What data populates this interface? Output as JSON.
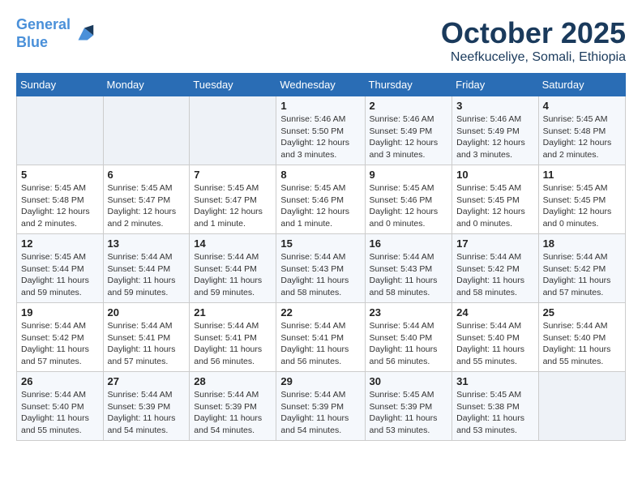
{
  "header": {
    "logo_line1": "General",
    "logo_line2": "Blue",
    "month": "October 2025",
    "location": "Neefkuceliye, Somali, Ethiopia"
  },
  "columns": [
    "Sunday",
    "Monday",
    "Tuesday",
    "Wednesday",
    "Thursday",
    "Friday",
    "Saturday"
  ],
  "weeks": [
    [
      {
        "day": "",
        "detail": ""
      },
      {
        "day": "",
        "detail": ""
      },
      {
        "day": "",
        "detail": ""
      },
      {
        "day": "1",
        "detail": "Sunrise: 5:46 AM\nSunset: 5:50 PM\nDaylight: 12 hours\nand 3 minutes."
      },
      {
        "day": "2",
        "detail": "Sunrise: 5:46 AM\nSunset: 5:49 PM\nDaylight: 12 hours\nand 3 minutes."
      },
      {
        "day": "3",
        "detail": "Sunrise: 5:46 AM\nSunset: 5:49 PM\nDaylight: 12 hours\nand 3 minutes."
      },
      {
        "day": "4",
        "detail": "Sunrise: 5:45 AM\nSunset: 5:48 PM\nDaylight: 12 hours\nand 2 minutes."
      }
    ],
    [
      {
        "day": "5",
        "detail": "Sunrise: 5:45 AM\nSunset: 5:48 PM\nDaylight: 12 hours\nand 2 minutes."
      },
      {
        "day": "6",
        "detail": "Sunrise: 5:45 AM\nSunset: 5:47 PM\nDaylight: 12 hours\nand 2 minutes."
      },
      {
        "day": "7",
        "detail": "Sunrise: 5:45 AM\nSunset: 5:47 PM\nDaylight: 12 hours\nand 1 minute."
      },
      {
        "day": "8",
        "detail": "Sunrise: 5:45 AM\nSunset: 5:46 PM\nDaylight: 12 hours\nand 1 minute."
      },
      {
        "day": "9",
        "detail": "Sunrise: 5:45 AM\nSunset: 5:46 PM\nDaylight: 12 hours\nand 0 minutes."
      },
      {
        "day": "10",
        "detail": "Sunrise: 5:45 AM\nSunset: 5:45 PM\nDaylight: 12 hours\nand 0 minutes."
      },
      {
        "day": "11",
        "detail": "Sunrise: 5:45 AM\nSunset: 5:45 PM\nDaylight: 12 hours\nand 0 minutes."
      }
    ],
    [
      {
        "day": "12",
        "detail": "Sunrise: 5:45 AM\nSunset: 5:44 PM\nDaylight: 11 hours\nand 59 minutes."
      },
      {
        "day": "13",
        "detail": "Sunrise: 5:44 AM\nSunset: 5:44 PM\nDaylight: 11 hours\nand 59 minutes."
      },
      {
        "day": "14",
        "detail": "Sunrise: 5:44 AM\nSunset: 5:44 PM\nDaylight: 11 hours\nand 59 minutes."
      },
      {
        "day": "15",
        "detail": "Sunrise: 5:44 AM\nSunset: 5:43 PM\nDaylight: 11 hours\nand 58 minutes."
      },
      {
        "day": "16",
        "detail": "Sunrise: 5:44 AM\nSunset: 5:43 PM\nDaylight: 11 hours\nand 58 minutes."
      },
      {
        "day": "17",
        "detail": "Sunrise: 5:44 AM\nSunset: 5:42 PM\nDaylight: 11 hours\nand 58 minutes."
      },
      {
        "day": "18",
        "detail": "Sunrise: 5:44 AM\nSunset: 5:42 PM\nDaylight: 11 hours\nand 57 minutes."
      }
    ],
    [
      {
        "day": "19",
        "detail": "Sunrise: 5:44 AM\nSunset: 5:42 PM\nDaylight: 11 hours\nand 57 minutes."
      },
      {
        "day": "20",
        "detail": "Sunrise: 5:44 AM\nSunset: 5:41 PM\nDaylight: 11 hours\nand 57 minutes."
      },
      {
        "day": "21",
        "detail": "Sunrise: 5:44 AM\nSunset: 5:41 PM\nDaylight: 11 hours\nand 56 minutes."
      },
      {
        "day": "22",
        "detail": "Sunrise: 5:44 AM\nSunset: 5:41 PM\nDaylight: 11 hours\nand 56 minutes."
      },
      {
        "day": "23",
        "detail": "Sunrise: 5:44 AM\nSunset: 5:40 PM\nDaylight: 11 hours\nand 56 minutes."
      },
      {
        "day": "24",
        "detail": "Sunrise: 5:44 AM\nSunset: 5:40 PM\nDaylight: 11 hours\nand 55 minutes."
      },
      {
        "day": "25",
        "detail": "Sunrise: 5:44 AM\nSunset: 5:40 PM\nDaylight: 11 hours\nand 55 minutes."
      }
    ],
    [
      {
        "day": "26",
        "detail": "Sunrise: 5:44 AM\nSunset: 5:40 PM\nDaylight: 11 hours\nand 55 minutes."
      },
      {
        "day": "27",
        "detail": "Sunrise: 5:44 AM\nSunset: 5:39 PM\nDaylight: 11 hours\nand 54 minutes."
      },
      {
        "day": "28",
        "detail": "Sunrise: 5:44 AM\nSunset: 5:39 PM\nDaylight: 11 hours\nand 54 minutes."
      },
      {
        "day": "29",
        "detail": "Sunrise: 5:44 AM\nSunset: 5:39 PM\nDaylight: 11 hours\nand 54 minutes."
      },
      {
        "day": "30",
        "detail": "Sunrise: 5:45 AM\nSunset: 5:39 PM\nDaylight: 11 hours\nand 53 minutes."
      },
      {
        "day": "31",
        "detail": "Sunrise: 5:45 AM\nSunset: 5:38 PM\nDaylight: 11 hours\nand 53 minutes."
      },
      {
        "day": "",
        "detail": ""
      }
    ]
  ]
}
